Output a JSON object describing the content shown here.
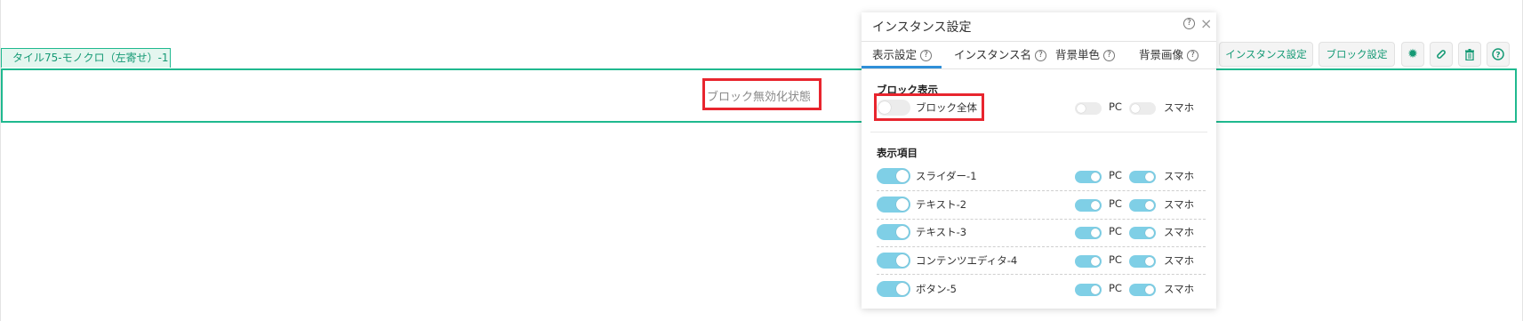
{
  "block": {
    "tab_label": "タイル75-モノクロ（左寄せ）-1",
    "disabled_text": "ブロック無効化状態"
  },
  "toolbar": {
    "instance_settings": "インスタンス設定",
    "block_settings": "ブロック設定",
    "icons": [
      "gear-icon",
      "link-icon",
      "trash-icon",
      "help-icon"
    ]
  },
  "panel": {
    "title": "インスタンス設定",
    "help": "?",
    "close": "×",
    "tabs": [
      {
        "label": "表示設定",
        "active": true
      },
      {
        "label": "インスタンス名",
        "active": false
      },
      {
        "label": "背景単色",
        "active": false
      },
      {
        "label": "背景画像",
        "active": false
      }
    ],
    "block_display": {
      "title": "ブロック表示",
      "all_label": "ブロック全体",
      "all_on": false,
      "pc_label": "PC",
      "pc_on": false,
      "sp_label": "スマホ",
      "sp_on": false
    },
    "items": {
      "title": "表示項目",
      "rows": [
        {
          "label": "スライダー-1",
          "on": true,
          "pc_label": "PC",
          "pc_on": true,
          "sp_label": "スマホ",
          "sp_on": true
        },
        {
          "label": "テキスト-2",
          "on": true,
          "pc_label": "PC",
          "pc_on": true,
          "sp_label": "スマホ",
          "sp_on": true
        },
        {
          "label": "テキスト-3",
          "on": true,
          "pc_label": "PC",
          "pc_on": true,
          "sp_label": "スマホ",
          "sp_on": true
        },
        {
          "label": "コンテンツエディタ-4",
          "on": true,
          "pc_label": "PC",
          "pc_on": true,
          "sp_label": "スマホ",
          "sp_on": true
        },
        {
          "label": "ボタン-5",
          "on": true,
          "pc_label": "PC",
          "pc_on": true,
          "sp_label": "スマホ",
          "sp_on": true
        }
      ]
    }
  },
  "colors": {
    "accent_green": "#1fb98f",
    "toggle_on": "#7fcfe6",
    "highlight_red": "#e8252e",
    "tab_active": "#2f8fd8"
  }
}
